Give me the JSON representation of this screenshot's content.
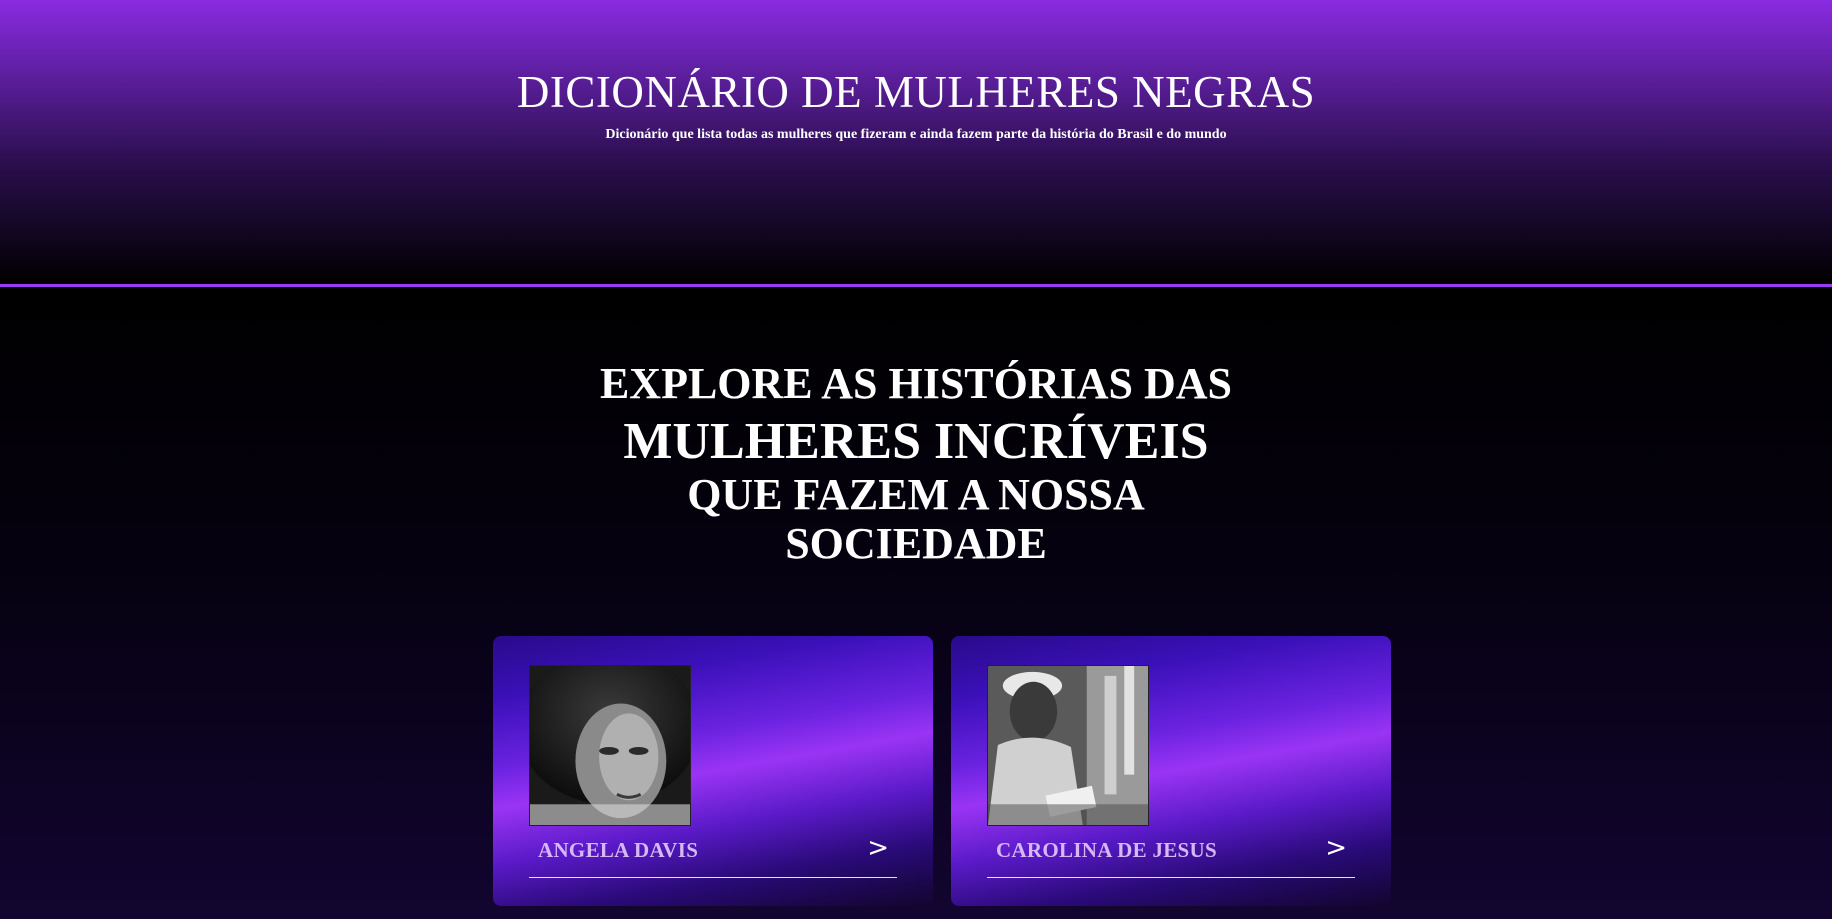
{
  "header": {
    "title": "DICIONÁRIO DE MULHERES NEGRAS",
    "subtitle": "Dicionário que lista todas as mulheres que fizeram e ainda fazem parte da história do Brasil e do mundo"
  },
  "hero": {
    "line1": "EXPLORE AS HISTÓRIAS DAS",
    "line2": "MULHERES INCRÍVEIS",
    "line3": "QUE FAZEM A NOSSA",
    "line4": "SOCIEDADE"
  },
  "cards": [
    {
      "name": "ANGELA DAVIS",
      "arrow": ">"
    },
    {
      "name": "CAROLINA DE JESUS",
      "arrow": ">"
    }
  ],
  "colors": {
    "accent": "#8a2be2",
    "divider": "#9a3cf0",
    "card_name": "#d6b8f6"
  }
}
